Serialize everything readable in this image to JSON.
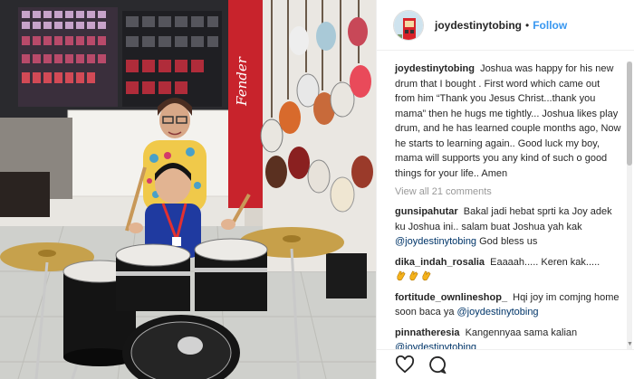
{
  "post": {
    "username": "joydestinytobing",
    "follow_label": "Follow",
    "dot": "•",
    "caption": "Joshua was happy for his new drum that I bought . First word which came out from him “Thank you Jesus Christ...thank you mama” then he hugs me tightly... Joshua likes play drum, and he has learned couple months ago, Now he starts to learning again.. Good luck my boy, mama will supports you any kind of such o good things for your life.. Amen",
    "view_all_comments": "View all 21 comments",
    "photo_store_sign": "Fender"
  },
  "comments": [
    {
      "user": "gunsipahutar",
      "text": "Bakal jadi hebat sprti ka Joy adek ku Joshua ini.. salam buat Joshua yah kak",
      "mention": "@joydestinytobing",
      "after": "God bless us"
    },
    {
      "user": "dika_indah_rosalia",
      "text": "Eaaaah..... Keren kak.....",
      "emoji": "clapping-hands-emoji x3"
    },
    {
      "user": "fortitude_ownlineshop_",
      "text": "Hqi joy im comjng home soon baca ya",
      "mention": "@joydestinytobing"
    },
    {
      "user": "pinnatheresia",
      "text": "Kangennyaa sama kalian",
      "mention": "@joydestinytobing"
    }
  ],
  "colors": {
    "follow_blue": "#3897f0",
    "mention_blue": "#003569",
    "muted_gray": "#999999"
  }
}
